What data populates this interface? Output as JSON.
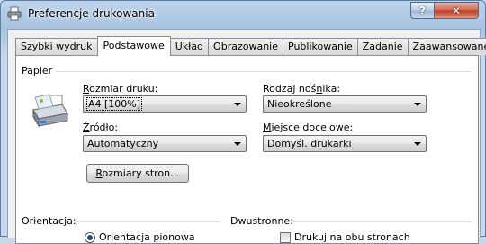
{
  "window": {
    "title": "Preferencje drukowania",
    "help_label": "?",
    "close_label": "✕"
  },
  "tabs": [
    {
      "label": "Szybki wydruk"
    },
    {
      "label": "Podstawowe"
    },
    {
      "label": "Układ"
    },
    {
      "label": "Obrazowanie"
    },
    {
      "label": "Publikowanie"
    },
    {
      "label": "Zadanie"
    },
    {
      "label": "Zaawansowane"
    }
  ],
  "active_tab": "Podstawowe",
  "paper": {
    "group_label": "Papier",
    "size_label": "Rozmiar druku:",
    "size_value": "A4  [100%]",
    "media_label": "Rodzaj nośnika:",
    "media_value": "Nieokreślone",
    "source_label": "Źródło:",
    "source_value": "Automatyczny",
    "destination_label": "Miejsce docelowe:",
    "destination_value": "Domyśl. drukarki",
    "page_sizes_button": "Rozmiary stron..."
  },
  "orientation": {
    "group_label": "Orientacja:",
    "option_portrait": "Orientacja pionowa"
  },
  "duplex": {
    "group_label": "Dwustronne:",
    "option_both_sides": "Drukuj na obu stronach"
  },
  "icons": {
    "app": "printer-icon",
    "paper": "printer-paper-icon"
  }
}
